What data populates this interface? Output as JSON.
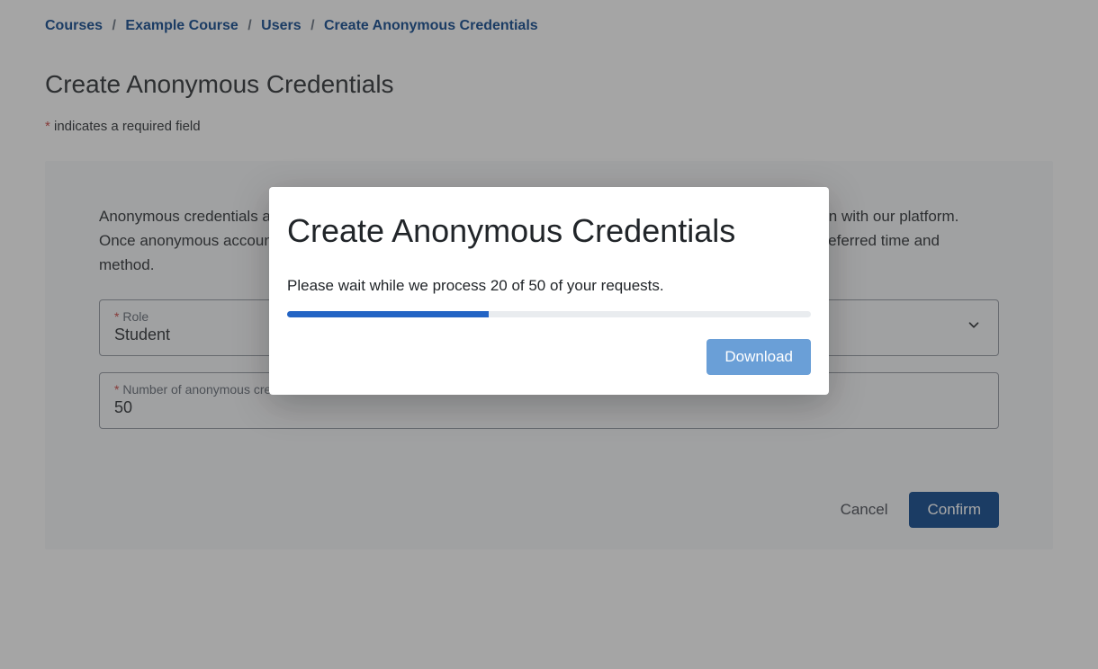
{
  "breadcrumb": {
    "items": [
      {
        "label": "Courses"
      },
      {
        "label": "Example Course"
      },
      {
        "label": "Users"
      },
      {
        "label": "Create Anonymous Credentials"
      }
    ],
    "separator": "/"
  },
  "page": {
    "title": "Create Anonymous Credentials",
    "required_note_prefix": "*",
    "required_note_text": " indicates a required field"
  },
  "panel": {
    "description": "Anonymous credentials allow you to add users to the course without sharing any of their personal information with our platform. Once anonymous accounts are created, you can distribute the credentials to your students or TAs at your preferred time and method.",
    "role_field": {
      "asterisk": "*",
      "label": " Role",
      "value": "Student"
    },
    "count_field": {
      "asterisk": "*",
      "label": " Number of anonymous credentials",
      "value": "50"
    }
  },
  "buttons": {
    "cancel": "Cancel",
    "confirm": "Confirm"
  },
  "modal": {
    "title": "Create Anonymous Credentials",
    "message": "Please wait while we process 20 of 50 of your requests.",
    "progress_percent": 38.5,
    "download": "Download"
  }
}
